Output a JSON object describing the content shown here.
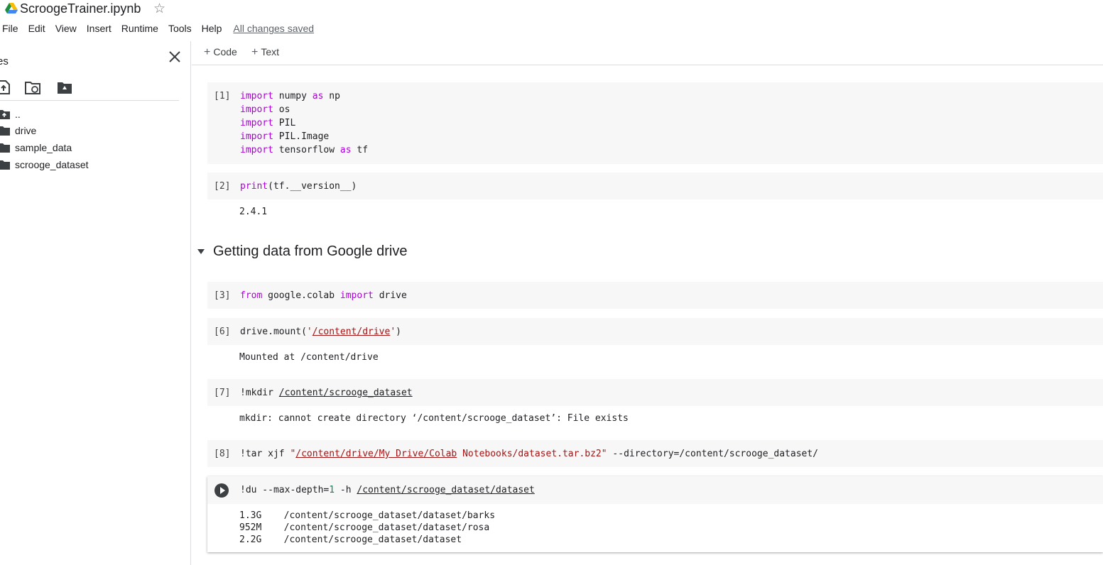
{
  "app": {
    "title": "ScroogeTrainer.ipynb",
    "save_status": "All changes saved"
  },
  "menu": [
    "File",
    "Edit",
    "View",
    "Insert",
    "Runtime",
    "Tools",
    "Help"
  ],
  "sidebar": {
    "title": "es",
    "files": [
      {
        "name": "..",
        "icon": "folder-up-icon"
      },
      {
        "name": "drive",
        "icon": "folder-icon"
      },
      {
        "name": "sample_data",
        "icon": "folder-icon"
      },
      {
        "name": "scrooge_dataset",
        "icon": "folder-icon"
      }
    ]
  },
  "toolbar": {
    "add_code": "Code",
    "add_text": "Text"
  },
  "section_title": "Getting data from Google drive",
  "cells": [
    {
      "prompt": "[1]"
    },
    {
      "prompt": "[2]",
      "output": "2.4.1"
    },
    {
      "prompt": "[3]"
    },
    {
      "prompt": "[6]",
      "output": "Mounted at /content/drive"
    },
    {
      "prompt": "[7]",
      "output": "mkdir: cannot create directory ‘/content/scrooge_dataset’: File exists"
    },
    {
      "prompt": "[8]"
    },
    {
      "prompt": "",
      "output": "1.3G\t/content/scrooge_dataset/dataset/barks\n952M\t/content/scrooge_dataset/dataset/rosa\n2.2G\t/content/scrooge_dataset/dataset"
    }
  ],
  "code": {
    "c1": {
      "kw_import": "import",
      "kw_as": "as",
      "l1a": "numpy",
      "l1b": "np",
      "l2": "os",
      "l3": "PIL",
      "l4": "PIL.Image",
      "l5a": "tensorflow",
      "l5b": "tf"
    },
    "c2": {
      "fn": "print",
      "rest": "(tf.__version__)"
    },
    "c3": {
      "kw_from": "from",
      "mod": "google.colab",
      "kw_import": "import",
      "name": "drive"
    },
    "c6": {
      "pre": "drive.mount(",
      "q": "'",
      "path": "/content/drive",
      "post": ")"
    },
    "c7": {
      "pre": "!mkdir",
      "path": "/content/scrooge_dataset"
    },
    "c8": {
      "pre": "!tar xjf",
      "q": "\"",
      "path": "/content/drive/My Drive/Colab",
      "path2": "Notebooks/dataset.tar.bz2",
      "post": "--directory=/content/scrooge_dataset/"
    },
    "c9": {
      "pre": "!du --max-depth=",
      "num": "1",
      "mid": "-h",
      "path": "/content/scrooge_dataset/dataset"
    }
  },
  "colors": {
    "keyword": "#af00db",
    "string": "#a31515",
    "number": "#098658",
    "cell_bg": "#f7f7f7"
  }
}
